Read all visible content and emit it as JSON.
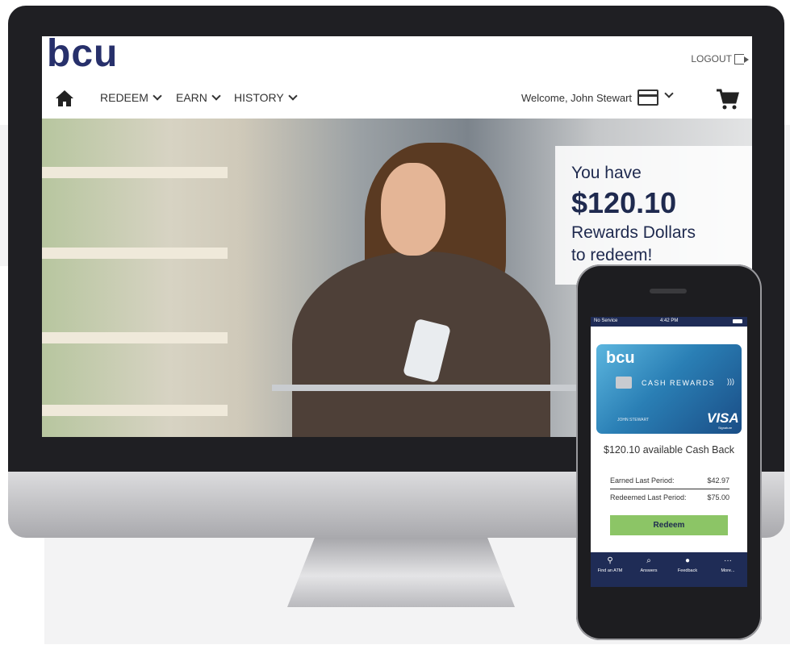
{
  "brand": {
    "logo": "bcu",
    "colors": {
      "navy": "#27306b",
      "green": "#8cc566",
      "status_bar": "#1f2c56"
    }
  },
  "header": {
    "logout_label": "LOGOUT",
    "nav": [
      {
        "label": "REDEEM"
      },
      {
        "label": "EARN"
      },
      {
        "label": "HISTORY"
      }
    ],
    "welcome": "Welcome, John Stewart",
    "icons": [
      "home-icon",
      "credit-card-icon",
      "shopping-cart-icon",
      "logout-icon"
    ]
  },
  "hero": {
    "promo": {
      "line1": "You have",
      "amount": "$120.10",
      "line2": "Rewards Dollars",
      "line3": "to redeem!"
    }
  },
  "phone": {
    "status": {
      "carrier": "No Service",
      "time": "4:42 PM"
    },
    "card": {
      "brand": "bcu",
      "type": "CASH REWARDS",
      "holder": "JOHN STEWART",
      "network": "VISA",
      "network_sub": "Signature"
    },
    "cashback_text": "$120.10 available Cash Back",
    "rows": [
      {
        "label": "Earned Last Period:",
        "value": "$42.97"
      },
      {
        "label": "Redeemed Last Period:",
        "value": "$75.00"
      }
    ],
    "redeem_label": "Redeem",
    "tabs": [
      {
        "label": "Find an ATM",
        "icon": "location-pin-icon"
      },
      {
        "label": "Answers",
        "icon": "search-icon"
      },
      {
        "label": "Feedback",
        "icon": "chat-bubble-icon"
      },
      {
        "label": "More...",
        "icon": "more-dots-icon"
      }
    ]
  }
}
